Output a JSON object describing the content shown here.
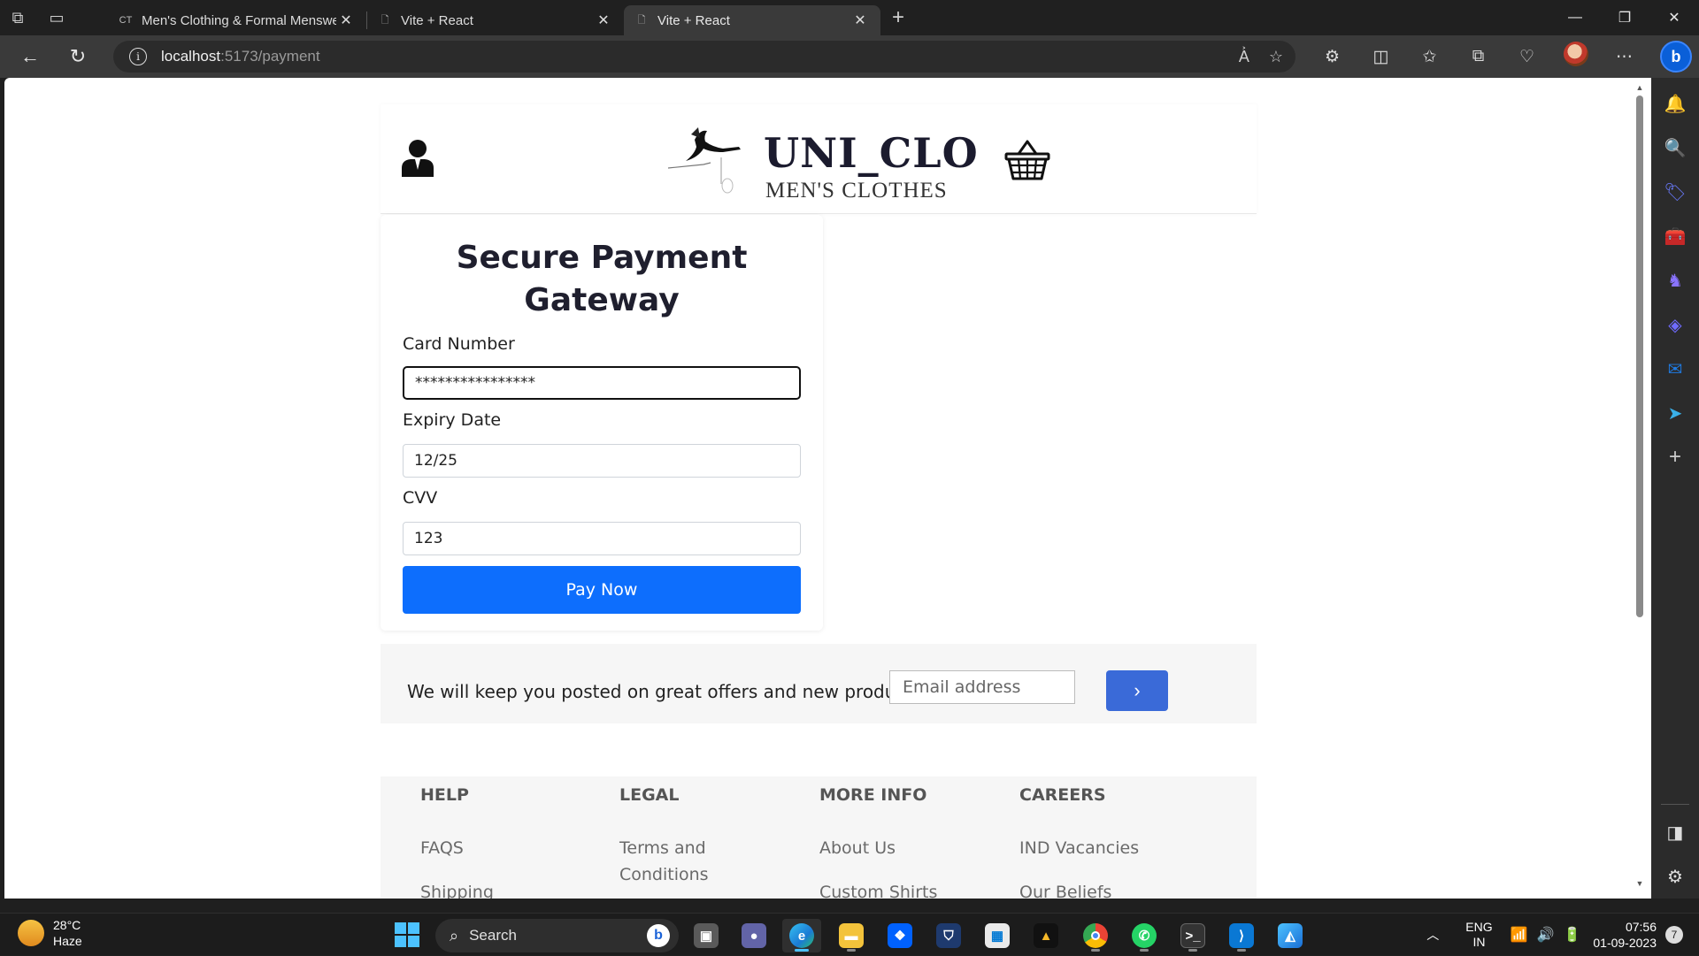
{
  "browser": {
    "tabs": [
      {
        "label": "Men's Clothing & Formal Menswear",
        "favicon": "CT"
      },
      {
        "label": "Vite + React"
      },
      {
        "label": "Vite + React",
        "active": true
      }
    ],
    "url_host": "localhost",
    "url_path": ":5173/payment"
  },
  "site": {
    "brand_name": "UNI_CLO",
    "brand_sub": "MEN'S CLOTHES"
  },
  "payment": {
    "title": "Secure Payment Gateway",
    "card_label": "Card Number",
    "card_value": "****************",
    "expiry_label": "Expiry Date",
    "expiry_value": "12/25",
    "cvv_label": "CVV",
    "cvv_value": "123",
    "pay_button": "Pay Now"
  },
  "newsletter": {
    "text": "We will keep you posted on great offers and new products",
    "email_placeholder": "Email address",
    "submit_icon": "chevron-right-icon"
  },
  "footer": {
    "columns": [
      {
        "heading": "HELP",
        "links": [
          "FAQS",
          "Shipping"
        ]
      },
      {
        "heading": "LEGAL",
        "links": [
          "Terms and Conditions"
        ]
      },
      {
        "heading": "MORE INFO",
        "links": [
          "About Us",
          "Custom Shirts"
        ]
      },
      {
        "heading": "CAREERS",
        "links": [
          "IND Vacancies",
          "Our Beliefs"
        ]
      }
    ]
  },
  "taskbar": {
    "temperature": "28°C",
    "weather": "Haze",
    "search_label": "Search",
    "lang_top": "ENG",
    "lang_bottom": "IN",
    "time": "07:56",
    "date": "01-09-2023",
    "notification_count": "7"
  },
  "colors": {
    "pay_button": "#0d6efd",
    "newsletter_button": "#3a6ad8"
  }
}
